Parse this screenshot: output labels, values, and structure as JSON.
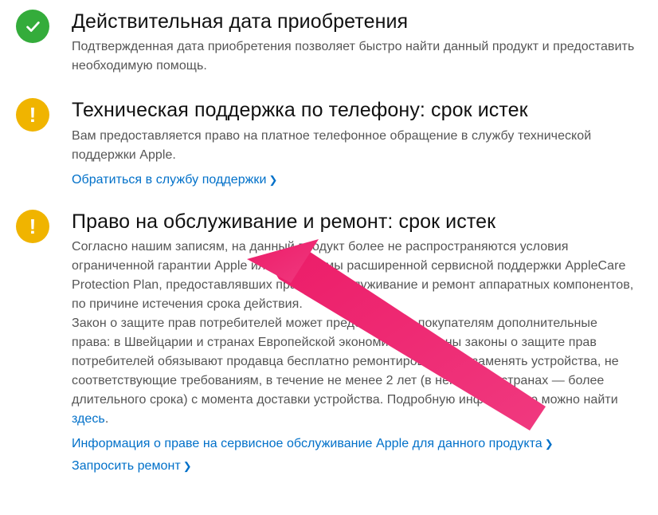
{
  "sections": [
    {
      "icon": "check",
      "icon_color": "green",
      "title": "Действительная дата приобретения",
      "body": "Подтвержденная дата приобретения позволяет быстро найти данный продукт и предоставить необходимую помощь.",
      "links": []
    },
    {
      "icon": "exclaim",
      "icon_color": "yellow",
      "title": "Техническая поддержка по телефону: срок истек",
      "body": "Вам предоставляется право на платное телефонное обращение в службу технической поддержки Apple.",
      "links": [
        {
          "label": "Обратиться в службу поддержки"
        }
      ]
    },
    {
      "icon": "exclaim",
      "icon_color": "yellow",
      "title": "Право на обслуживание и ремонт: срок истек",
      "body_parts": {
        "p1": "Согласно нашим записям, на данный продукт более не распространяются условия ограниченной гарантии Apple или программы расширенной сервисной поддержки AppleCare Protection Plan, предоставлявших право на обслуживание и ремонт аппаратных компонентов, по причине истечения срока действия.",
        "p2a": "Закон о защите прав потребителей может предоставлять покупателям дополнительные права: в Швейцарии и странах Европейской экономической зоны законы о защите прав потребителей обязывают продавца бесплатно ремонтировать или заменять устройства, не соответствующие требованиям, в течение не менее 2 лет (в некоторых странах — более длительного срока) с момента доставки устройства. Подробную информацию можно найти ",
        "p2_link": "здесь",
        "p2b": "."
      },
      "links": [
        {
          "label": "Информация о праве на сервисное обслуживание Apple для данного продукта"
        },
        {
          "label": "Запросить ремонт"
        }
      ]
    }
  ],
  "colors": {
    "green": "#34ac3b",
    "yellow": "#f0b400",
    "link": "#0070c9",
    "arrow": "#ec1c68"
  }
}
